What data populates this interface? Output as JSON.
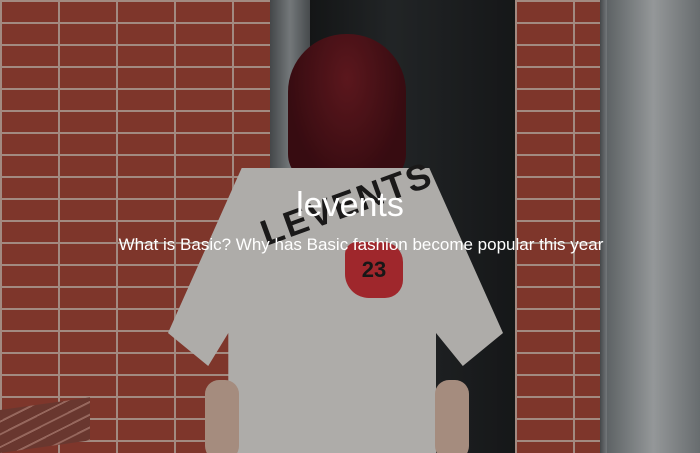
{
  "logo": {
    "text": "levents",
    "color": "#ffffff"
  },
  "headline": {
    "text": "What is Basic? Why has Basic fashion become popular this year"
  },
  "print": {
    "text": "LEVENTS",
    "badge_number": "23",
    "badge_color": "#d4343b"
  },
  "colors": {
    "brick": "#a9493a",
    "shirt": "#e9e6e2",
    "hair": "#5a141c"
  }
}
